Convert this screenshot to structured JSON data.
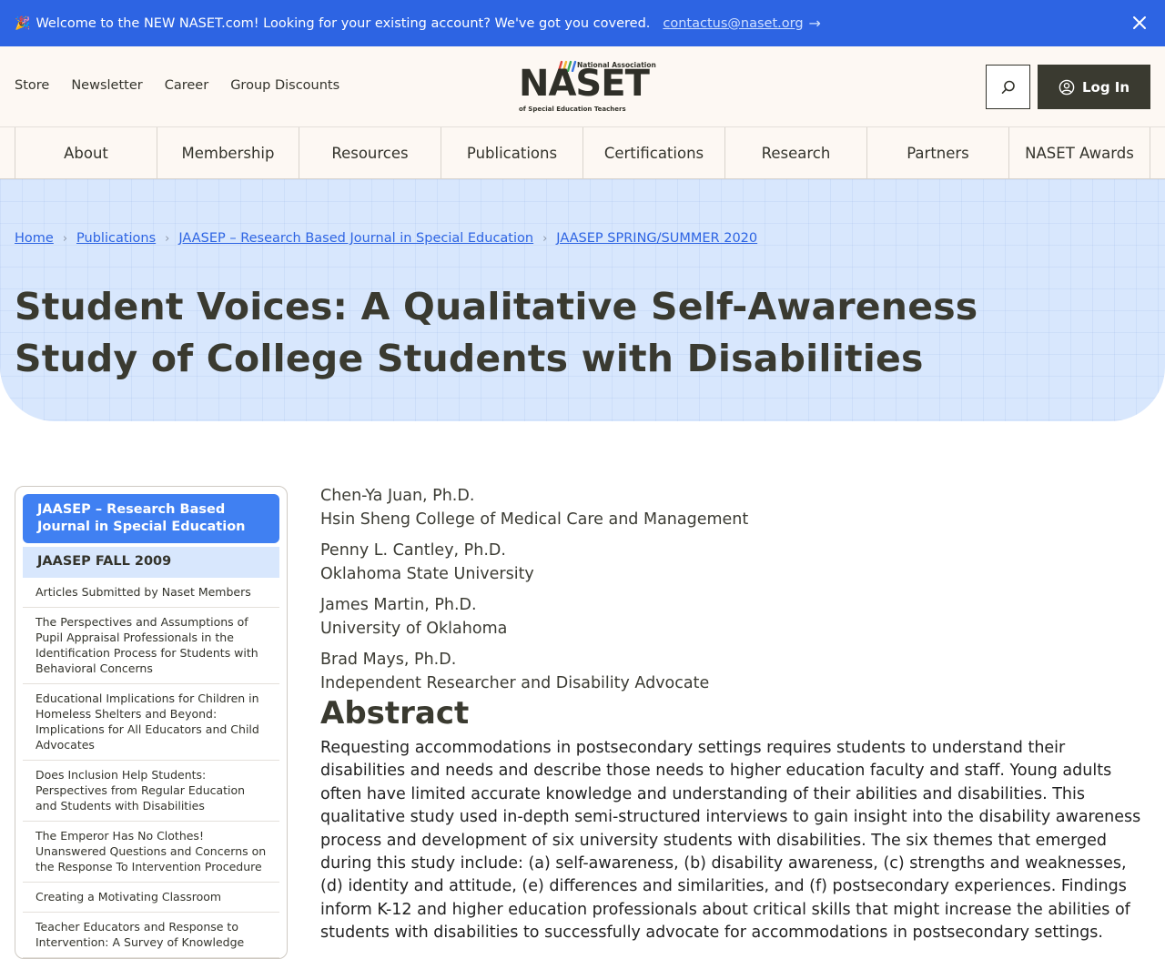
{
  "announcement": {
    "emoji": "🎉",
    "message": "Welcome to the NEW NASET.com! Looking for your existing account? We've got you covered.",
    "email": "contactus@naset.org"
  },
  "header": {
    "utility_links": [
      "Store",
      "Newsletter",
      "Career",
      "Group Discounts"
    ],
    "logo": {
      "top_text": "National Association",
      "main_text": "NASET",
      "bottom_text": "of Special Education Teachers"
    },
    "login_label": "Log In"
  },
  "nav": {
    "items": [
      "About",
      "Membership",
      "Resources",
      "Publications",
      "Certifications",
      "Research",
      "Partners",
      "NASET Awards"
    ]
  },
  "breadcrumb": {
    "items": [
      "Home",
      "Publications",
      "JAASEP – Research Based Journal in Special Education",
      "JAASEP SPRING/SUMMER 2020"
    ]
  },
  "page_title": "Student Voices: A Qualitative Self-Awareness Study of College Students with Disabilities",
  "sidebar": {
    "heading": "JAASEP – Research Based Journal in Special Education",
    "subheading": "JAASEP FALL 2009",
    "items": [
      "Articles Submitted by Naset Members",
      "The Perspectives and Assumptions of Pupil Appraisal Professionals in the Identification Process for Students with Behavioral Concerns",
      "Educational Implications for Children in Homeless Shelters and Beyond: Implications for All Educators and Child Advocates",
      "Does Inclusion Help Students: Perspectives from Regular Education and Students with Disabilities",
      "The Emperor Has No Clothes! Unanswered Questions and Concerns on the Response To Intervention Procedure",
      "Creating a Motivating Classroom",
      "Teacher Educators and Response to Intervention: A Survey of Knowledge"
    ]
  },
  "authors": [
    {
      "name": "Chen-Ya Juan, Ph.D.",
      "affiliation": "Hsin Sheng College of Medical Care and Management"
    },
    {
      "name": "Penny L. Cantley, Ph.D.",
      "affiliation": "Oklahoma State University"
    },
    {
      "name": "James Martin, Ph.D.",
      "affiliation": "University of Oklahoma"
    },
    {
      "name": "Brad Mays, Ph.D.",
      "affiliation": "Independent Researcher and Disability Advocate"
    }
  ],
  "abstract": {
    "heading": "Abstract",
    "text": "Requesting accommodations in postsecondary settings requires students to understand their disabilities and needs and describe those needs to higher education faculty and staff. Young adults often have limited accurate knowledge and understanding of their abilities and disabilities. This qualitative study used in-depth semi-structured interviews to gain insight into the disability awareness process and development of six university students with disabilities. The six themes that emerged during this study include: (a) self-awareness, (b) disability awareness, (c) strengths and weaknesses, (d) identity and attitude, (e) differences and similarities, and (f) postsecondary experiences.  Findings inform K-12 and higher education professionals about critical skills that might increase the abilities of students with disabilities to successfully advocate for accommodations in postsecondary settings."
  },
  "colors": {
    "announcement_bg": "#2d64e3",
    "header_bg": "#fdf8f3",
    "hero_bg": "#d8e7fd",
    "sidebar_active": "#4080f2",
    "dark_button": "#3a3a30"
  }
}
